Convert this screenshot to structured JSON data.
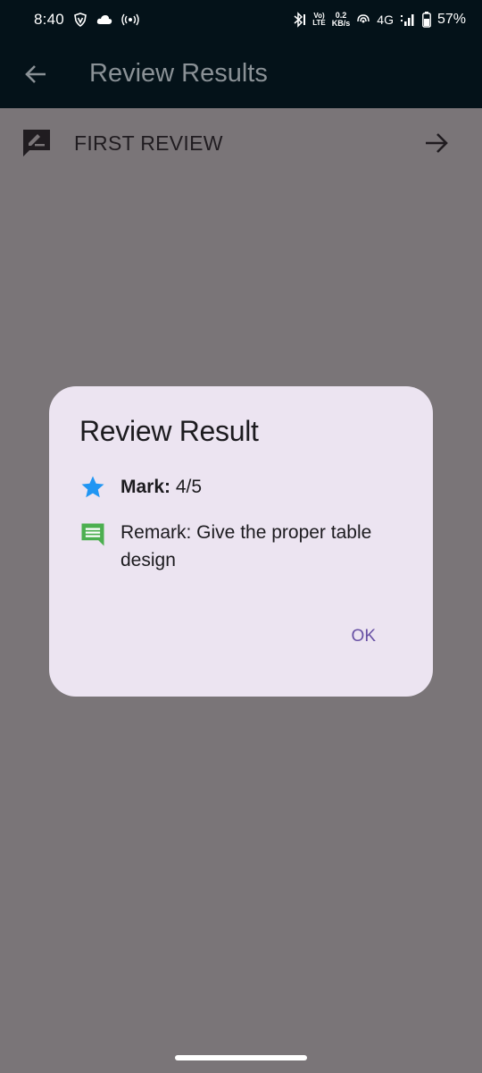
{
  "status_bar": {
    "time": "8:40",
    "net_speed_value": "0.2",
    "net_speed_unit": "KB/s",
    "volte_top": "Vo)",
    "volte_bottom": "LTE",
    "network_type": "4G",
    "battery_percent": "57%",
    "icons": [
      "vpn-shield-icon",
      "cloud-icon",
      "hotspot-icon",
      "bluetooth-icon",
      "wifi-calling-icon",
      "signal-icon",
      "battery-icon"
    ]
  },
  "app_bar": {
    "back_icon": "arrow-left-icon",
    "title": "Review Results"
  },
  "list": {
    "items": [
      {
        "icon": "rate-review-icon",
        "label": "FIRST REVIEW",
        "trailing_icon": "arrow-right-icon"
      }
    ]
  },
  "dialog": {
    "title": "Review Result",
    "mark": {
      "icon": "star-icon",
      "label": "Mark:",
      "value": "4/5"
    },
    "remark": {
      "icon": "comment-icon",
      "text": "Remark: Give the proper table design"
    },
    "ok_label": "OK"
  },
  "colors": {
    "status_bar_bg": "#041219",
    "scrim": "#7a7578",
    "dialog_bg": "#ece4f1",
    "star": "#2196f3",
    "comment": "#4caf50",
    "button_text": "#6750a4"
  }
}
